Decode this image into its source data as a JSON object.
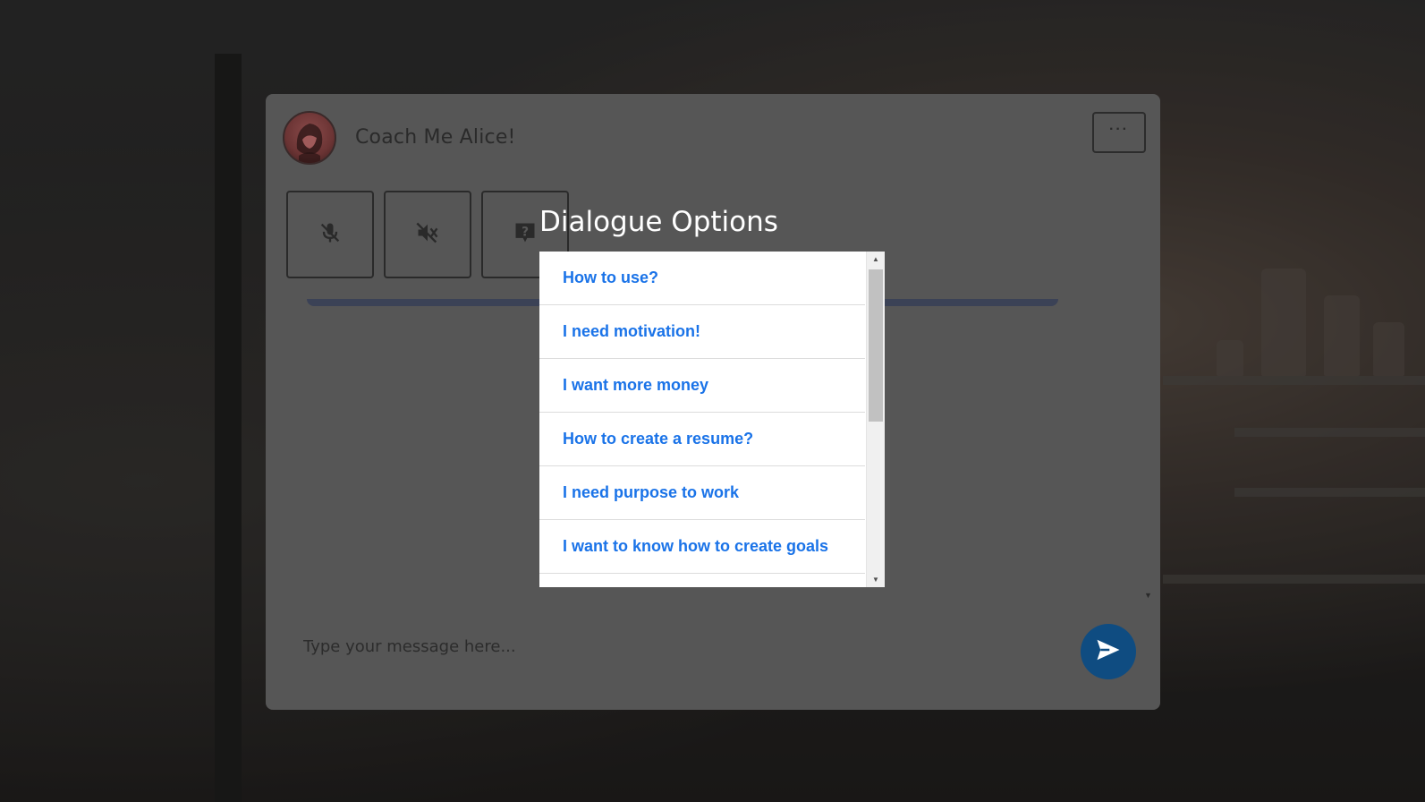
{
  "header": {
    "title": "Coach Me Alice!",
    "menu_label": "···"
  },
  "controls": {
    "mic_icon": "mic-off-icon",
    "speaker_icon": "speaker-mute-icon",
    "help_icon": "help-bubble-icon"
  },
  "input": {
    "placeholder": "Type your message here..."
  },
  "dialog": {
    "title": "Dialogue Options",
    "options": [
      "How to use?",
      "I need motivation!",
      "I want more money",
      "How to create a resume?",
      "I need purpose to work",
      "I want to know how to create goals",
      ""
    ]
  },
  "colors": {
    "accent": "#1a73e8",
    "send_button": "#0f4c81",
    "progress_bar": "#3b4256"
  }
}
